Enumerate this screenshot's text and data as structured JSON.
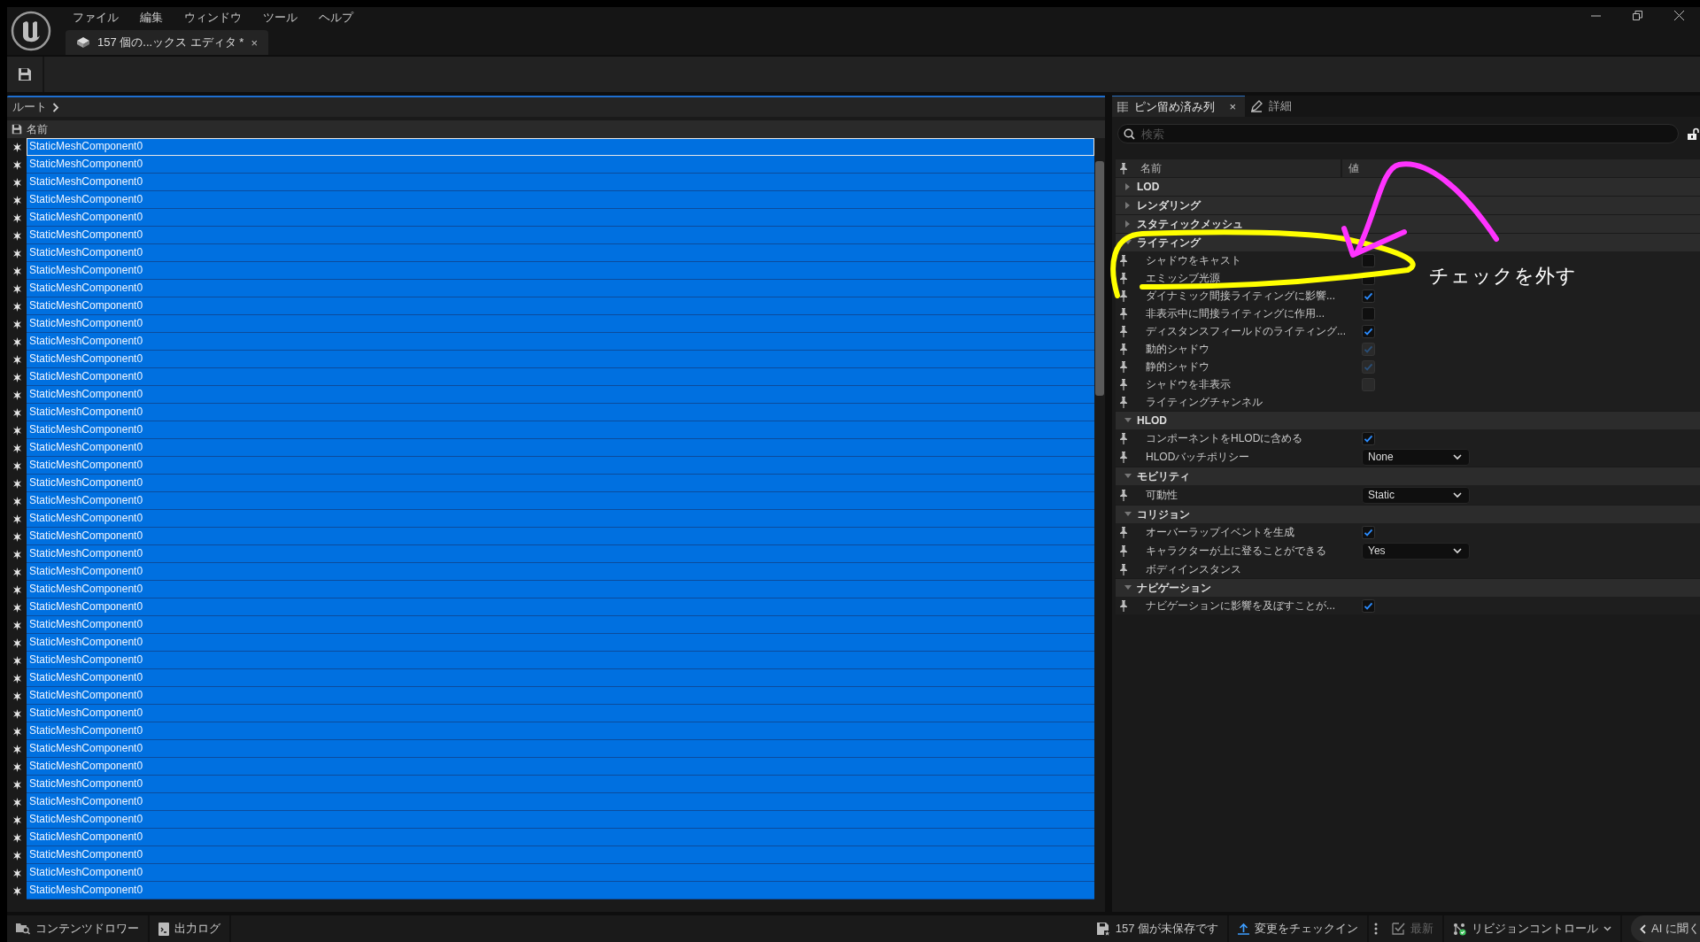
{
  "menu": [
    "ファイル",
    "編集",
    "ウィンドウ",
    "ツール",
    "ヘルプ"
  ],
  "document_tab": {
    "label": "157 個の...ックス エディタ *",
    "close": "×"
  },
  "breadcrumb": {
    "label": "ルート"
  },
  "outliner": {
    "column": "名前",
    "rows": [
      {
        "name": "StaticMeshComponent0",
        "selected": true,
        "focused": true
      },
      {
        "name": "StaticMeshComponent0",
        "selected": true,
        "focused": false
      },
      {
        "name": "StaticMeshComponent0",
        "selected": true,
        "focused": false
      },
      {
        "name": "StaticMeshComponent0",
        "selected": true,
        "focused": false
      },
      {
        "name": "StaticMeshComponent0",
        "selected": true,
        "focused": false
      },
      {
        "name": "StaticMeshComponent0",
        "selected": true,
        "focused": false
      },
      {
        "name": "StaticMeshComponent0",
        "selected": true,
        "focused": false
      },
      {
        "name": "StaticMeshComponent0",
        "selected": true,
        "focused": false
      },
      {
        "name": "StaticMeshComponent0",
        "selected": true,
        "focused": false
      },
      {
        "name": "StaticMeshComponent0",
        "selected": true,
        "focused": false
      },
      {
        "name": "StaticMeshComponent0",
        "selected": true,
        "focused": false
      },
      {
        "name": "StaticMeshComponent0",
        "selected": true,
        "focused": false
      },
      {
        "name": "StaticMeshComponent0",
        "selected": true,
        "focused": false
      },
      {
        "name": "StaticMeshComponent0",
        "selected": true,
        "focused": false
      },
      {
        "name": "StaticMeshComponent0",
        "selected": true,
        "focused": false
      },
      {
        "name": "StaticMeshComponent0",
        "selected": true,
        "focused": false
      },
      {
        "name": "StaticMeshComponent0",
        "selected": true,
        "focused": false
      },
      {
        "name": "StaticMeshComponent0",
        "selected": true,
        "focused": false
      },
      {
        "name": "StaticMeshComponent0",
        "selected": true,
        "focused": false
      },
      {
        "name": "StaticMeshComponent0",
        "selected": true,
        "focused": false
      },
      {
        "name": "StaticMeshComponent0",
        "selected": true,
        "focused": false
      },
      {
        "name": "StaticMeshComponent0",
        "selected": true,
        "focused": false
      },
      {
        "name": "StaticMeshComponent0",
        "selected": true,
        "focused": false
      },
      {
        "name": "StaticMeshComponent0",
        "selected": true,
        "focused": false
      },
      {
        "name": "StaticMeshComponent0",
        "selected": true,
        "focused": false
      },
      {
        "name": "StaticMeshComponent0",
        "selected": true,
        "focused": false
      },
      {
        "name": "StaticMeshComponent0",
        "selected": true,
        "focused": false
      },
      {
        "name": "StaticMeshComponent0",
        "selected": true,
        "focused": false
      },
      {
        "name": "StaticMeshComponent0",
        "selected": true,
        "focused": false
      },
      {
        "name": "StaticMeshComponent0",
        "selected": true,
        "focused": false
      },
      {
        "name": "StaticMeshComponent0",
        "selected": true,
        "focused": false
      },
      {
        "name": "StaticMeshComponent0",
        "selected": true,
        "focused": false
      },
      {
        "name": "StaticMeshComponent0",
        "selected": true,
        "focused": false
      },
      {
        "name": "StaticMeshComponent0",
        "selected": true,
        "focused": false
      },
      {
        "name": "StaticMeshComponent0",
        "selected": true,
        "focused": false
      },
      {
        "name": "StaticMeshComponent0",
        "selected": true,
        "focused": false
      },
      {
        "name": "StaticMeshComponent0",
        "selected": true,
        "focused": false
      },
      {
        "name": "StaticMeshComponent0",
        "selected": true,
        "focused": false
      },
      {
        "name": "StaticMeshComponent0",
        "selected": true,
        "focused": false
      },
      {
        "name": "StaticMeshComponent0",
        "selected": true,
        "focused": false
      },
      {
        "name": "StaticMeshComponent0",
        "selected": true,
        "focused": false
      },
      {
        "name": "StaticMeshComponent0",
        "selected": true,
        "focused": false
      },
      {
        "name": "StaticMeshComponent0",
        "selected": true,
        "focused": false
      }
    ]
  },
  "details": {
    "tabs": [
      {
        "label": "ピン留め済み列",
        "selected": true,
        "close": "×"
      },
      {
        "label": "詳細",
        "selected": false
      }
    ],
    "search": {
      "placeholder": "検索"
    },
    "columns": [
      "名前",
      "値"
    ],
    "categories": [
      {
        "name": "LOD",
        "expanded": false
      },
      {
        "name": "レンダリング",
        "expanded": false
      },
      {
        "name": "スタティックメッシュ",
        "expanded": false
      },
      {
        "name": "ライティング",
        "expanded": true,
        "properties": [
          {
            "label": "シャドウをキャスト",
            "kind": "checkbox",
            "checked": false,
            "disabled": false
          },
          {
            "label": "エミッシブ光源",
            "kind": "checkbox",
            "checked": false,
            "disabled": false
          },
          {
            "label": "ダイナミック間接ライティングに影響...",
            "kind": "checkbox",
            "checked": true,
            "disabled": false
          },
          {
            "label": "非表示中に間接ライティングに作用...",
            "kind": "checkbox",
            "checked": false,
            "disabled": false
          },
          {
            "label": "ディスタンスフィールドのライティング...",
            "kind": "checkbox",
            "checked": true,
            "disabled": false
          },
          {
            "label": "動的シャドウ",
            "kind": "checkbox",
            "checked": true,
            "disabled": true
          },
          {
            "label": "静的シャドウ",
            "kind": "checkbox",
            "checked": true,
            "disabled": true
          },
          {
            "label": "シャドウを非表示",
            "kind": "checkbox",
            "checked": false,
            "disabled": true
          },
          {
            "label": "ライティングチャンネル",
            "kind": "group"
          }
        ]
      },
      {
        "name": "HLOD",
        "expanded": true,
        "properties": [
          {
            "label": "コンポーネントをHLODに含める",
            "kind": "checkbox",
            "checked": true,
            "disabled": false
          },
          {
            "label": "HLODバッチポリシー",
            "kind": "dropdown",
            "value": "None"
          }
        ]
      },
      {
        "name": "モビリティ",
        "expanded": true,
        "properties": [
          {
            "label": "可動性",
            "kind": "dropdown",
            "value": "Static"
          }
        ]
      },
      {
        "name": "コリジョン",
        "expanded": true,
        "properties": [
          {
            "label": "オーバーラップイベントを生成",
            "kind": "checkbox",
            "checked": true,
            "disabled": false
          },
          {
            "label": "キャラクターが上に登ることができる",
            "kind": "dropdown",
            "value": "Yes"
          },
          {
            "label": "ボディインスタンス",
            "kind": "group"
          }
        ]
      },
      {
        "name": "ナビゲーション",
        "expanded": true,
        "properties": [
          {
            "label": "ナビゲーションに影響を及ぼすことが...",
            "kind": "checkbox",
            "checked": true,
            "disabled": false
          }
        ]
      }
    ]
  },
  "annotation": {
    "text": "チェックを外す"
  },
  "status_bar": {
    "left": [
      {
        "label": "コンテンツドロワー",
        "kind": "drawer"
      },
      {
        "label": "出力ログ",
        "kind": "log"
      }
    ],
    "right": [
      {
        "label": "157 個が未保存です",
        "kind": "unsaved",
        "disabled": false
      },
      {
        "label": "変更をチェックイン",
        "kind": "checkin",
        "disabled": false
      },
      {
        "label": "最新",
        "kind": "sync",
        "disabled": true
      },
      {
        "label": "リビジョンコントロール",
        "kind": "revision",
        "disabled": false
      },
      {
        "label": "AI に聞く",
        "kind": "ai",
        "disabled": false
      }
    ]
  }
}
